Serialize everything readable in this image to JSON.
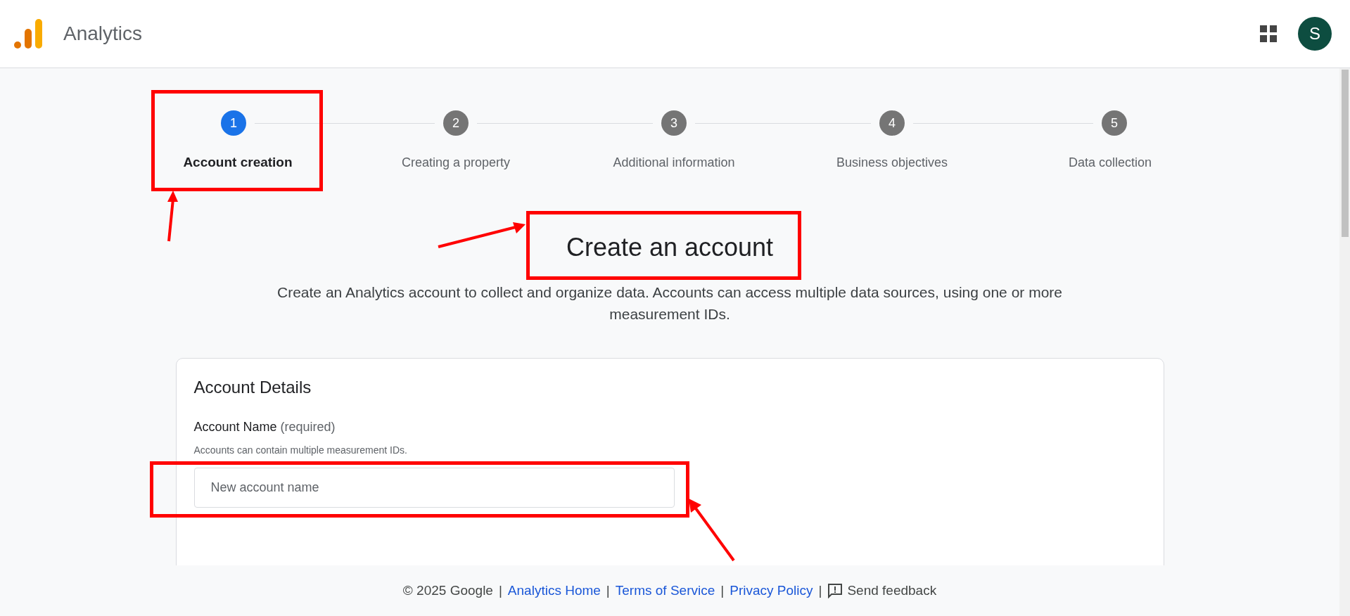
{
  "header": {
    "product": "Analytics",
    "avatar": "S"
  },
  "steps": [
    {
      "number": "1",
      "label": "Account creation",
      "selected": true,
      "highlighted": true
    },
    {
      "number": "2",
      "label": "Creating a property",
      "selected": false,
      "highlighted": false
    },
    {
      "number": "3",
      "label": "Additional information",
      "selected": false,
      "highlighted": false
    },
    {
      "number": "4",
      "label": "Business objectives",
      "selected": false,
      "highlighted": false
    },
    {
      "number": "5",
      "label": "Data collection",
      "selected": false,
      "highlighted": false
    }
  ],
  "page": {
    "title": "Create an account",
    "title_highlighted": true,
    "description": "Create an Analytics account to collect and organize data. Accounts can access multiple data sources, using one or more measurement IDs."
  },
  "card": {
    "title": "Account Details",
    "field": {
      "label": "Account Name",
      "suffix": "(required)",
      "helper": "Accounts can contain multiple measurement IDs.",
      "placeholder": "New account name",
      "highlighted": true
    }
  },
  "footer": {
    "copyright": "© 2025 Google",
    "separator": "|",
    "links": [
      "Analytics Home",
      "Terms of Service",
      "Privacy Policy"
    ],
    "feedback": "Send feedback"
  }
}
